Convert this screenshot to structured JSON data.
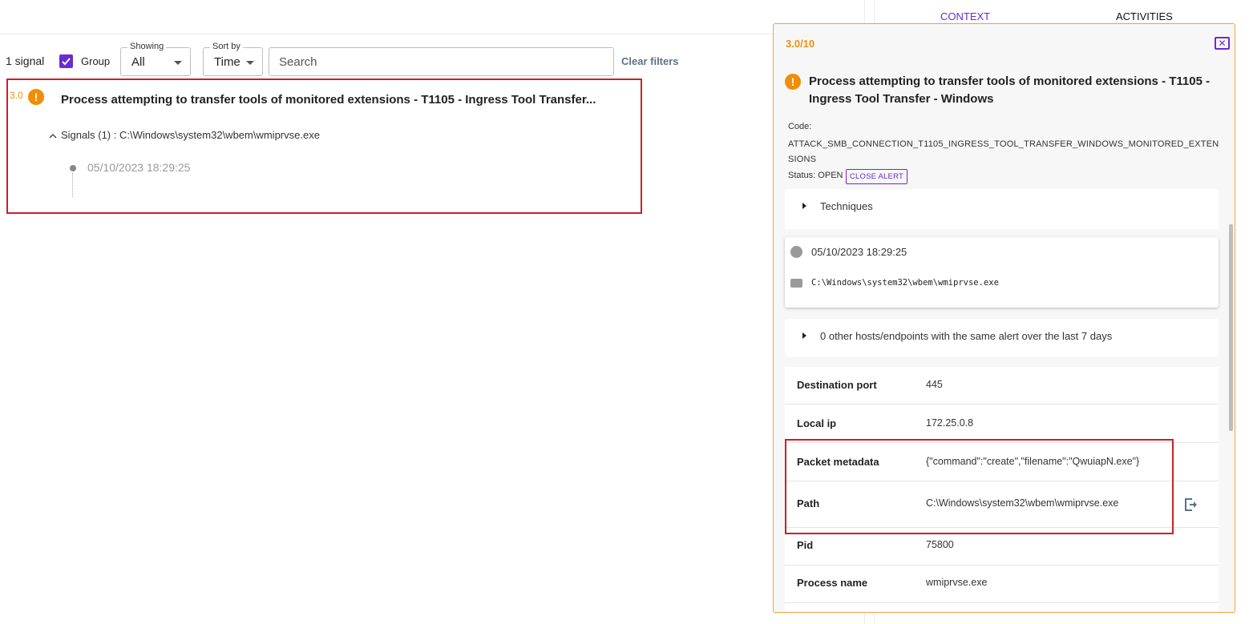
{
  "toolbar": {
    "count": "1 signal",
    "group_label": "Group",
    "showing": {
      "label": "Showing",
      "value": "All"
    },
    "sort_by": {
      "label": "Sort by",
      "value": "Time"
    },
    "search_placeholder": "Search",
    "clear_filters": "Clear filters"
  },
  "signal": {
    "score": "3.0",
    "title": "Process attempting to transfer tools of monitored extensions - T1105 - Ingress Tool Transfer...",
    "signals_line": "Signals (1) : C:\\Windows\\system32\\wbem\\wmiprvse.exe",
    "time": "05/10/2023 18:29:25"
  },
  "tabs": [
    {
      "label": "CONTEXT",
      "active": true
    },
    {
      "label": "ACTIVITIES",
      "active": false
    }
  ],
  "panel": {
    "score": "3.0/10",
    "close": "✕",
    "title": "Process attempting to transfer tools of monitored extensions - T1105 - Ingress Tool Transfer - Windows",
    "code_label": "Code:",
    "code_value": "ATTACK_SMB_CONNECTION_T1105_INGRESS_TOOL_TRANSFER_WINDOWS_MONITORED_EXTENSIONS",
    "status": "Status: OPEN",
    "close_alert": "CLOSE ALERT",
    "techniques": "Techniques",
    "event_time": "05/10/2023 18:29:25",
    "event_path": "C:\\Windows\\system32\\wbem\\wmiprvse.exe",
    "hosts_text": "0 other hosts/endpoints with the same alert over the last 7 days",
    "properties": [
      {
        "key": "Destination port",
        "value": "445"
      },
      {
        "key": "Local ip",
        "value": "172.25.0.8"
      },
      {
        "key": "Packet metadata",
        "value": "{\"command\":\"create\",\"filename\":\"QwuiapN.exe\"}"
      },
      {
        "key": "Path",
        "value": "C:\\Windows\\system32\\wbem\\wmiprvse.exe"
      },
      {
        "key": "Pid",
        "value": "75800"
      },
      {
        "key": "Process name",
        "value": "wmiprvse.exe"
      }
    ]
  },
  "colors": {
    "accent": "#6a2bd4",
    "warning": "#f28d00",
    "highlight": "#c8202a"
  }
}
